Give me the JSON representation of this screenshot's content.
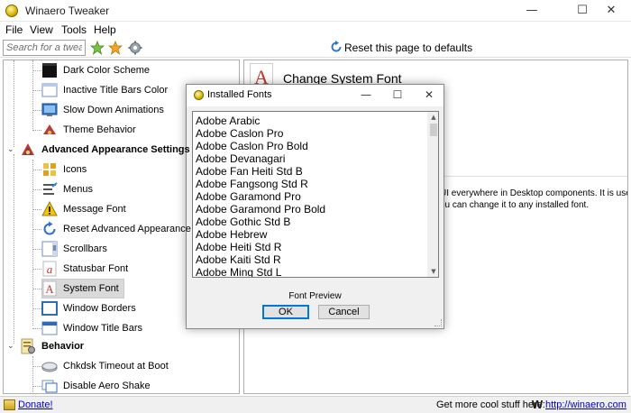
{
  "window": {
    "title": "Winaero Tweaker",
    "controls": {
      "minimize": "—",
      "maximize": "☐",
      "close": "✕"
    }
  },
  "menu": [
    "File",
    "View",
    "Tools",
    "Help"
  ],
  "toolbar": {
    "search_placeholder": "Search for a tweak...",
    "reset_label": "Reset this page to defaults",
    "icons": [
      "green-star-icon",
      "orange-star-icon",
      "gear-icon"
    ]
  },
  "tree": {
    "rows": [
      {
        "label": "Dark Color Scheme",
        "icon": "dark-color-scheme-icon",
        "level": 1
      },
      {
        "label": "Inactive Title Bars Color",
        "icon": "inactive-title-bars-icon",
        "level": 1
      },
      {
        "label": "Slow Down Animations",
        "icon": "slow-animations-icon",
        "level": 1
      },
      {
        "label": "Theme Behavior",
        "icon": "theme-behavior-icon",
        "level": 1
      },
      {
        "label": "Advanced Appearance Settings",
        "icon": "advanced-appearance-icon",
        "level": 0,
        "expanded": true
      },
      {
        "label": "Icons",
        "icon": "icons-icon",
        "level": 1
      },
      {
        "label": "Menus",
        "icon": "menus-icon",
        "level": 1
      },
      {
        "label": "Message Font",
        "icon": "message-font-icon",
        "level": 1
      },
      {
        "label": "Reset Advanced Appearance",
        "icon": "reset-appearance-icon",
        "level": 1
      },
      {
        "label": "Scrollbars",
        "icon": "scrollbars-icon",
        "level": 1
      },
      {
        "label": "Statusbar Font",
        "icon": "statusbar-font-icon",
        "level": 1
      },
      {
        "label": "System Font",
        "icon": "system-font-icon",
        "level": 1,
        "selected": true
      },
      {
        "label": "Window Borders",
        "icon": "window-borders-icon",
        "level": 1
      },
      {
        "label": "Window Title Bars",
        "icon": "window-title-bars-icon",
        "level": 1
      },
      {
        "label": "Behavior",
        "icon": "behavior-icon",
        "level": 0,
        "expanded": true
      },
      {
        "label": "Chkdsk Timeout at Boot",
        "icon": "chkdsk-icon",
        "level": 1
      },
      {
        "label": "Disable Aero Shake",
        "icon": "aero-shake-icon",
        "level": 1
      }
    ]
  },
  "content": {
    "title": "Change System Font",
    "description_line1": "UI everywhere in Desktop components. It is used",
    "description_line2": "ou can change it to any installed font."
  },
  "dialog": {
    "title": "Installed Fonts",
    "fonts": [
      "Adobe Arabic",
      "Adobe Caslon Pro",
      "Adobe Caslon Pro Bold",
      "Adobe Devanagari",
      "Adobe Fan Heiti Std B",
      "Adobe Fangsong Std R",
      "Adobe Garamond Pro",
      "Adobe Garamond Pro Bold",
      "Adobe Gothic Std B",
      "Adobe Hebrew",
      "Adobe Heiti Std R",
      "Adobe Kaiti Std R",
      "Adobe Ming Std L"
    ],
    "preview_label": "Font Preview",
    "ok_label": "OK",
    "cancel_label": "Cancel"
  },
  "statusbar": {
    "donate_label": "Donate!",
    "cool_text": "Get more cool stuff here:",
    "logo_letter": "W",
    "site_link": "http://winaero.com"
  },
  "colors": {
    "link": "#0000cc",
    "ok_border": "#0078d7",
    "selection": "#d9d9d9"
  }
}
